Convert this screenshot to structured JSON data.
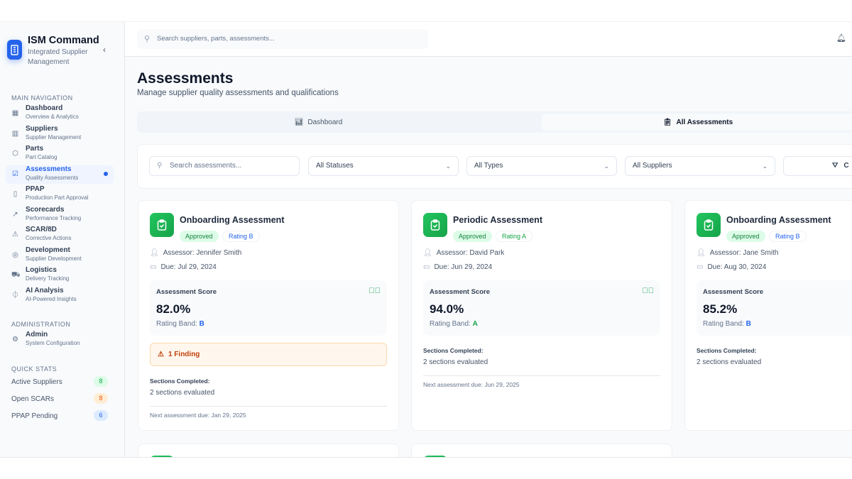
{
  "app": {
    "title": "ISM Command",
    "subtitle": "Integrated Supplier Management"
  },
  "sidebar": {
    "main_heading": "MAIN NAVIGATION",
    "items": [
      {
        "label": "Dashboard",
        "sub": "Overview & Analytics",
        "icon": "grid-icon"
      },
      {
        "label": "Suppliers",
        "sub": "Supplier Management",
        "icon": "building-icon"
      },
      {
        "label": "Parts",
        "sub": "Part Catalog",
        "icon": "box-icon"
      },
      {
        "label": "Assessments",
        "sub": "Quality Assessments",
        "icon": "clipboard-check-icon",
        "active": true
      },
      {
        "label": "PPAP",
        "sub": "Production Part Approval",
        "icon": "file-check-icon"
      },
      {
        "label": "Scorecards",
        "sub": "Performance Tracking",
        "icon": "trend-icon"
      },
      {
        "label": "SCAR/8D",
        "sub": "Corrective Actions",
        "icon": "warning-icon"
      },
      {
        "label": "Development",
        "sub": "Supplier Development",
        "icon": "target-icon"
      },
      {
        "label": "Logistics",
        "sub": "Delivery Tracking",
        "icon": "truck-icon"
      },
      {
        "label": "AI Analysis",
        "sub": "AI-Powered Insights",
        "icon": "brain-icon"
      }
    ],
    "admin_heading": "ADMINISTRATION",
    "admin_items": [
      {
        "label": "Admin",
        "sub": "System Configuration",
        "icon": "gear-icon"
      }
    ],
    "stats_heading": "QUICK STATS",
    "stats": [
      {
        "label": "Active Suppliers",
        "value": "8",
        "color": "#16a34a",
        "bg": "#dcfce7"
      },
      {
        "label": "Open SCARs",
        "value": "8",
        "color": "#ea580c",
        "bg": "#ffedd5"
      },
      {
        "label": "PPAP Pending",
        "value": "6",
        "color": "#2563eb",
        "bg": "#dbeafe"
      }
    ]
  },
  "header": {
    "search_placeholder": "Search suppliers, parts, assessments..."
  },
  "page": {
    "title": "Assessments",
    "subtitle": "Manage supplier quality assessments and qualifications"
  },
  "tabs": [
    {
      "label": "Dashboard"
    },
    {
      "label": "All Assessments",
      "active": true
    }
  ],
  "filters": {
    "search_placeholder": "Search assessments...",
    "status": "All Statuses",
    "type": "All Types",
    "supplier": "All Suppliers",
    "button_partial": "C"
  },
  "cards": [
    {
      "title": "Onboarding Assessment",
      "status": "Approved",
      "rating": "Rating B",
      "assessor": "Assessor: Jennifer Smith",
      "due": "Due: Jul 29, 2024",
      "score_label": "Assessment Score",
      "score": "82.0%",
      "band_label": "Rating Band:",
      "band": "B",
      "finding": "1 Finding",
      "sections_label": "Sections Completed:",
      "sections": "2 sections evaluated",
      "next": "Next assessment due: Jan 29, 2025"
    },
    {
      "title": "Periodic Assessment",
      "status": "Approved",
      "rating": "Rating A",
      "assessor": "Assessor: David Park",
      "due": "Due: Jun 29, 2024",
      "score_label": "Assessment Score",
      "score": "94.0%",
      "band_label": "Rating Band:",
      "band": "A",
      "band_color": "#16a34a",
      "rating_color": "#16a34a",
      "sections_label": "Sections Completed:",
      "sections": "2 sections evaluated",
      "next": "Next assessment due: Jun 29, 2025"
    },
    {
      "title": "Onboarding Assessment",
      "status": "Approved",
      "rating": "Rating B",
      "assessor": "Assessor: Jane Smith",
      "due": "Due: Aug 30, 2024",
      "score_label": "Assessment Score",
      "score": "85.2%",
      "band_label": "Rating Band:",
      "band": "B",
      "sections_label": "Sections Completed:",
      "sections": "2 sections evaluated"
    }
  ]
}
